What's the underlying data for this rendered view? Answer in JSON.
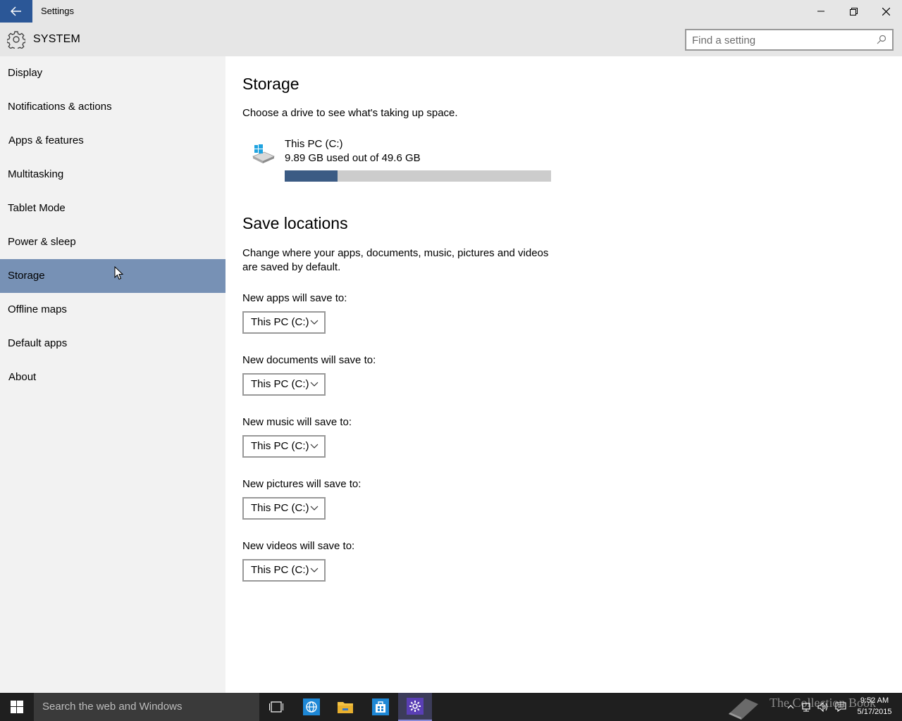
{
  "window": {
    "title": "Settings"
  },
  "header": {
    "section_title": "SYSTEM",
    "search_placeholder": "Find a setting"
  },
  "sidebar": {
    "items": [
      {
        "label": "Display"
      },
      {
        "label": "Notifications & actions"
      },
      {
        "label": "Apps & features"
      },
      {
        "label": "Multitasking"
      },
      {
        "label": "Tablet Mode"
      },
      {
        "label": "Power & sleep"
      },
      {
        "label": "Storage",
        "selected": true
      },
      {
        "label": "Offline maps"
      },
      {
        "label": "Default apps"
      },
      {
        "label": "About"
      }
    ]
  },
  "main": {
    "storage_heading": "Storage",
    "storage_description": "Choose a drive to see what's taking up space.",
    "drive": {
      "name": "This PC (C:)",
      "usage_text": "9.89 GB used out of 49.6 GB",
      "used_fraction": 0.199
    },
    "save_heading": "Save locations",
    "save_description_line1": "Change where your apps, documents, music, pictures and videos",
    "save_description_line2": "are saved by default.",
    "save_locations": [
      {
        "label": "New apps will save to:",
        "value": "This PC (C:)"
      },
      {
        "label": "New documents will save to:",
        "value": "This PC (C:)"
      },
      {
        "label": "New music will save to:",
        "value": "This PC (C:)"
      },
      {
        "label": "New pictures will save to:",
        "value": "This PC (C:)"
      },
      {
        "label": "New videos will save to:",
        "value": "This PC (C:)"
      }
    ]
  },
  "taskbar": {
    "search_text": "Search the web and Windows",
    "watermark": "The Collection Book",
    "time": "9:52 AM",
    "date": "5/17/2015"
  },
  "colors": {
    "accent": "#2b5797",
    "selected_nav": "#7791b5",
    "progress_fill": "#3b5b84",
    "progress_track": "#cccccc",
    "taskbar": "#1f1f1f"
  }
}
